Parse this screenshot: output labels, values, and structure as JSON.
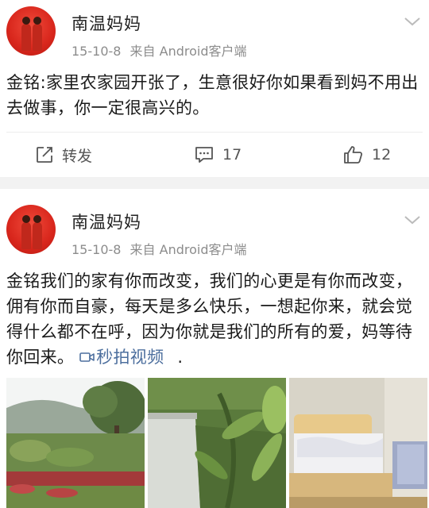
{
  "posts": [
    {
      "author": "南温妈妈",
      "date": "15-10-8",
      "source": "来自 Android客户端",
      "text": "金铭:家里农家园开张了，生意很好你如果看到妈不用出去做事，你一定很高兴的。",
      "actions": {
        "repost_label": "转发",
        "comments": "17",
        "likes": "12"
      }
    },
    {
      "author": "南温妈妈",
      "date": "15-10-8",
      "source": "来自 Android客户端",
      "text": "金铭我们的家有你而改变，我们的心更是有你而改变，佣有你而自豪，每天是多么快乐，一想起你来，就会觉得什么都不在呼，因为你就是我们的所有的爱，妈等待你回来。",
      "video_link": "秒拍视频",
      "trailing": "."
    }
  ],
  "icons": {
    "repost": "repost-icon",
    "comment": "comment-icon",
    "like": "like-icon",
    "more": "chevron-down-icon",
    "video": "video-icon"
  },
  "colors": {
    "link": "#4d6f9e",
    "meta": "#8c8c8c",
    "separator": "#f2f2f2"
  }
}
